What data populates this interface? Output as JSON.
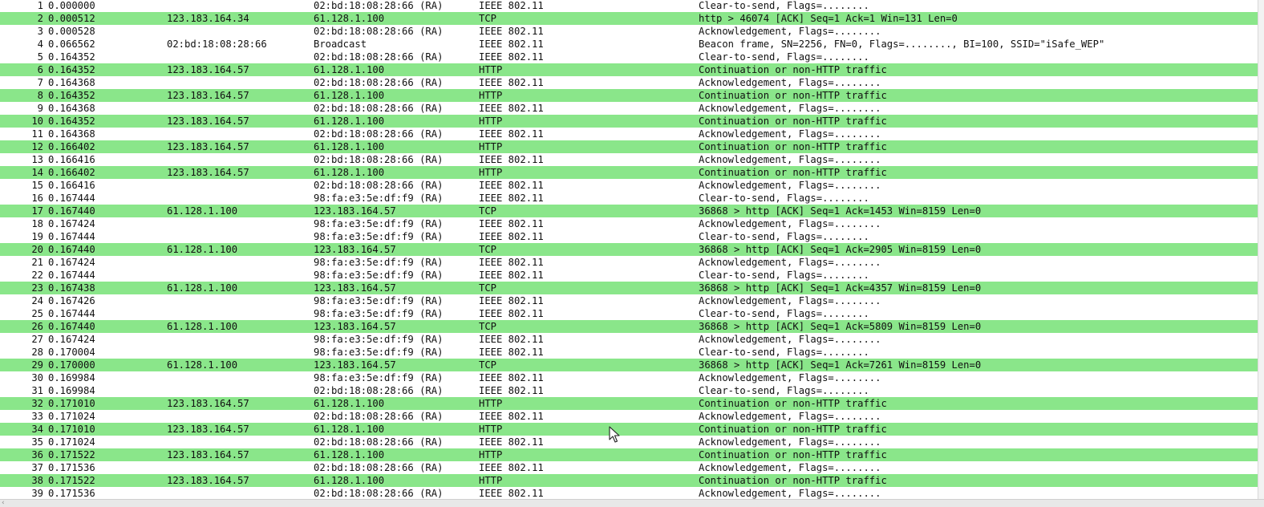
{
  "packets": [
    {
      "no": "1",
      "time": "0.000000",
      "source": "",
      "destination": "02:bd:18:08:28:66 (RA)",
      "protocol": "IEEE 802.11",
      "info": "Clear-to-send, Flags=........",
      "highlight": false
    },
    {
      "no": "2",
      "time": "0.000512",
      "source": "123.183.164.34",
      "destination": "61.128.1.100",
      "protocol": "TCP",
      "info": "http > 46074 [ACK] Seq=1 Ack=1 Win=131 Len=0",
      "highlight": true
    },
    {
      "no": "3",
      "time": "0.000528",
      "source": "",
      "destination": "02:bd:18:08:28:66 (RA)",
      "protocol": "IEEE 802.11",
      "info": "Acknowledgement, Flags=........",
      "highlight": false
    },
    {
      "no": "4",
      "time": "0.066562",
      "source": "02:bd:18:08:28:66",
      "destination": "Broadcast",
      "protocol": "IEEE 802.11",
      "info": "Beacon frame, SN=2256, FN=0, Flags=........, BI=100, SSID=\"iSafe_WEP\"",
      "highlight": false
    },
    {
      "no": "5",
      "time": "0.164352",
      "source": "",
      "destination": "02:bd:18:08:28:66 (RA)",
      "protocol": "IEEE 802.11",
      "info": "Clear-to-send, Flags=........",
      "highlight": false
    },
    {
      "no": "6",
      "time": "0.164352",
      "source": "123.183.164.57",
      "destination": "61.128.1.100",
      "protocol": "HTTP",
      "info": "Continuation or non-HTTP traffic",
      "highlight": true
    },
    {
      "no": "7",
      "time": "0.164368",
      "source": "",
      "destination": "02:bd:18:08:28:66 (RA)",
      "protocol": "IEEE 802.11",
      "info": "Acknowledgement, Flags=........",
      "highlight": false
    },
    {
      "no": "8",
      "time": "0.164352",
      "source": "123.183.164.57",
      "destination": "61.128.1.100",
      "protocol": "HTTP",
      "info": "Continuation or non-HTTP traffic",
      "highlight": true
    },
    {
      "no": "9",
      "time": "0.164368",
      "source": "",
      "destination": "02:bd:18:08:28:66 (RA)",
      "protocol": "IEEE 802.11",
      "info": "Acknowledgement, Flags=........",
      "highlight": false
    },
    {
      "no": "10",
      "time": "0.164352",
      "source": "123.183.164.57",
      "destination": "61.128.1.100",
      "protocol": "HTTP",
      "info": "Continuation or non-HTTP traffic",
      "highlight": true
    },
    {
      "no": "11",
      "time": "0.164368",
      "source": "",
      "destination": "02:bd:18:08:28:66 (RA)",
      "protocol": "IEEE 802.11",
      "info": "Acknowledgement, Flags=........",
      "highlight": false
    },
    {
      "no": "12",
      "time": "0.166402",
      "source": "123.183.164.57",
      "destination": "61.128.1.100",
      "protocol": "HTTP",
      "info": "Continuation or non-HTTP traffic",
      "highlight": true
    },
    {
      "no": "13",
      "time": "0.166416",
      "source": "",
      "destination": "02:bd:18:08:28:66 (RA)",
      "protocol": "IEEE 802.11",
      "info": "Acknowledgement, Flags=........",
      "highlight": false
    },
    {
      "no": "14",
      "time": "0.166402",
      "source": "123.183.164.57",
      "destination": "61.128.1.100",
      "protocol": "HTTP",
      "info": "Continuation or non-HTTP traffic",
      "highlight": true
    },
    {
      "no": "15",
      "time": "0.166416",
      "source": "",
      "destination": "02:bd:18:08:28:66 (RA)",
      "protocol": "IEEE 802.11",
      "info": "Acknowledgement, Flags=........",
      "highlight": false
    },
    {
      "no": "16",
      "time": "0.167444",
      "source": "",
      "destination": "98:fa:e3:5e:df:f9 (RA)",
      "protocol": "IEEE 802.11",
      "info": "Clear-to-send, Flags=........",
      "highlight": false
    },
    {
      "no": "17",
      "time": "0.167440",
      "source": "61.128.1.100",
      "destination": "123.183.164.57",
      "protocol": "TCP",
      "info": "36868 > http [ACK] Seq=1 Ack=1453 Win=8159 Len=0",
      "highlight": true
    },
    {
      "no": "18",
      "time": "0.167424",
      "source": "",
      "destination": "98:fa:e3:5e:df:f9 (RA)",
      "protocol": "IEEE 802.11",
      "info": "Acknowledgement, Flags=........",
      "highlight": false
    },
    {
      "no": "19",
      "time": "0.167444",
      "source": "",
      "destination": "98:fa:e3:5e:df:f9 (RA)",
      "protocol": "IEEE 802.11",
      "info": "Clear-to-send, Flags=........",
      "highlight": false
    },
    {
      "no": "20",
      "time": "0.167440",
      "source": "61.128.1.100",
      "destination": "123.183.164.57",
      "protocol": "TCP",
      "info": "36868 > http [ACK] Seq=1 Ack=2905 Win=8159 Len=0",
      "highlight": true
    },
    {
      "no": "21",
      "time": "0.167424",
      "source": "",
      "destination": "98:fa:e3:5e:df:f9 (RA)",
      "protocol": "IEEE 802.11",
      "info": "Acknowledgement, Flags=........",
      "highlight": false
    },
    {
      "no": "22",
      "time": "0.167444",
      "source": "",
      "destination": "98:fa:e3:5e:df:f9 (RA)",
      "protocol": "IEEE 802.11",
      "info": "Clear-to-send, Flags=........",
      "highlight": false
    },
    {
      "no": "23",
      "time": "0.167438",
      "source": "61.128.1.100",
      "destination": "123.183.164.57",
      "protocol": "TCP",
      "info": "36868 > http [ACK] Seq=1 Ack=4357 Win=8159 Len=0",
      "highlight": true
    },
    {
      "no": "24",
      "time": "0.167426",
      "source": "",
      "destination": "98:fa:e3:5e:df:f9 (RA)",
      "protocol": "IEEE 802.11",
      "info": "Acknowledgement, Flags=........",
      "highlight": false
    },
    {
      "no": "25",
      "time": "0.167444",
      "source": "",
      "destination": "98:fa:e3:5e:df:f9 (RA)",
      "protocol": "IEEE 802.11",
      "info": "Clear-to-send, Flags=........",
      "highlight": false
    },
    {
      "no": "26",
      "time": "0.167440",
      "source": "61.128.1.100",
      "destination": "123.183.164.57",
      "protocol": "TCP",
      "info": "36868 > http [ACK] Seq=1 Ack=5809 Win=8159 Len=0",
      "highlight": true
    },
    {
      "no": "27",
      "time": "0.167424",
      "source": "",
      "destination": "98:fa:e3:5e:df:f9 (RA)",
      "protocol": "IEEE 802.11",
      "info": "Acknowledgement, Flags=........",
      "highlight": false
    },
    {
      "no": "28",
      "time": "0.170004",
      "source": "",
      "destination": "98:fa:e3:5e:df:f9 (RA)",
      "protocol": "IEEE 802.11",
      "info": "Clear-to-send, Flags=........",
      "highlight": false
    },
    {
      "no": "29",
      "time": "0.170000",
      "source": "61.128.1.100",
      "destination": "123.183.164.57",
      "protocol": "TCP",
      "info": "36868 > http [ACK] Seq=1 Ack=7261 Win=8159 Len=0",
      "highlight": true
    },
    {
      "no": "30",
      "time": "0.169984",
      "source": "",
      "destination": "98:fa:e3:5e:df:f9 (RA)",
      "protocol": "IEEE 802.11",
      "info": "Acknowledgement, Flags=........",
      "highlight": false
    },
    {
      "no": "31",
      "time": "0.169984",
      "source": "",
      "destination": "02:bd:18:08:28:66 (RA)",
      "protocol": "IEEE 802.11",
      "info": "Clear-to-send, Flags=........",
      "highlight": false
    },
    {
      "no": "32",
      "time": "0.171010",
      "source": "123.183.164.57",
      "destination": "61.128.1.100",
      "protocol": "HTTP",
      "info": "Continuation or non-HTTP traffic",
      "highlight": true
    },
    {
      "no": "33",
      "time": "0.171024",
      "source": "",
      "destination": "02:bd:18:08:28:66 (RA)",
      "protocol": "IEEE 802.11",
      "info": "Acknowledgement, Flags=........",
      "highlight": false
    },
    {
      "no": "34",
      "time": "0.171010",
      "source": "123.183.164.57",
      "destination": "61.128.1.100",
      "protocol": "HTTP",
      "info": "Continuation or non-HTTP traffic",
      "highlight": true
    },
    {
      "no": "35",
      "time": "0.171024",
      "source": "",
      "destination": "02:bd:18:08:28:66 (RA)",
      "protocol": "IEEE 802.11",
      "info": "Acknowledgement, Flags=........",
      "highlight": false
    },
    {
      "no": "36",
      "time": "0.171522",
      "source": "123.183.164.57",
      "destination": "61.128.1.100",
      "protocol": "HTTP",
      "info": "Continuation or non-HTTP traffic",
      "highlight": true
    },
    {
      "no": "37",
      "time": "0.171536",
      "source": "",
      "destination": "02:bd:18:08:28:66 (RA)",
      "protocol": "IEEE 802.11",
      "info": "Acknowledgement, Flags=........",
      "highlight": false
    },
    {
      "no": "38",
      "time": "0.171522",
      "source": "123.183.164.57",
      "destination": "61.128.1.100",
      "protocol": "HTTP",
      "info": "Continuation or non-HTTP traffic",
      "highlight": true
    },
    {
      "no": "39",
      "time": "0.171536",
      "source": "",
      "destination": "02:bd:18:08:28:66 (RA)",
      "protocol": "IEEE 802.11",
      "info": "Acknowledgement, Flags=........",
      "highlight": false
    }
  ],
  "colors": {
    "highlight_row": "#8ae68a",
    "normal_row": "#ffffff",
    "text": "#111111"
  },
  "scrollbar": {
    "left_arrow_icon": "chevron-left-icon",
    "left_arrow_glyph": "‹"
  },
  "cursor": {
    "icon": "mouse-pointer-icon"
  }
}
